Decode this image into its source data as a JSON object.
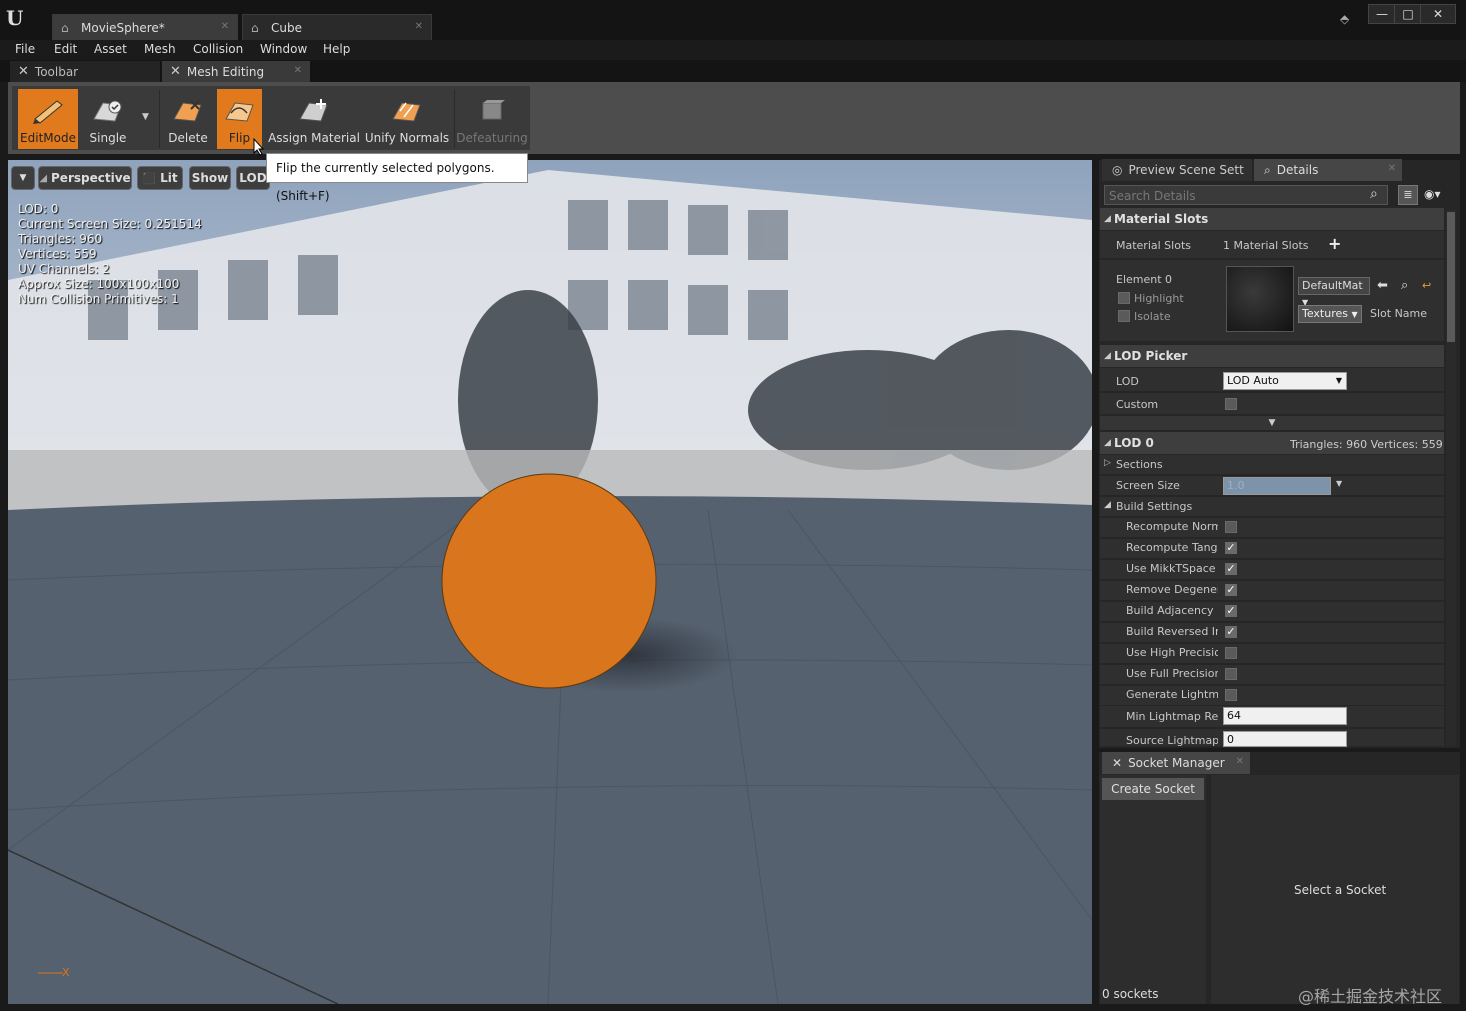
{
  "window": {
    "tabs": [
      {
        "label": "MovieSphere*",
        "icon": "home-icon"
      },
      {
        "label": "Cube",
        "icon": "home-icon"
      }
    ],
    "controls": {
      "minimize": "—",
      "maximize": "□",
      "close": "✕"
    }
  },
  "menu": [
    "File",
    "Edit",
    "Asset",
    "Mesh",
    "Collision",
    "Window",
    "Help"
  ],
  "tool_tabs": [
    {
      "label": "Toolbar",
      "icon": "wrench-icon"
    },
    {
      "label": "Mesh Editing",
      "icon": "wrench-icon"
    }
  ],
  "toolbar": {
    "buttons": [
      {
        "label": "EditMode",
        "icon": "pencil-icon",
        "state": "active"
      },
      {
        "label": "Single",
        "icon": "select-polygon-icon",
        "state": "normal"
      },
      {
        "label": "Delete",
        "icon": "delete-polygon-icon",
        "state": "normal"
      },
      {
        "label": "Flip",
        "icon": "flip-polygon-icon",
        "state": "hovered"
      },
      {
        "label": "Assign Material",
        "icon": "assign-material-icon",
        "state": "normal"
      },
      {
        "label": "Unify Normals",
        "icon": "unify-normals-icon",
        "state": "normal"
      },
      {
        "label": "Defeaturing",
        "icon": "defeaturing-icon",
        "state": "disabled"
      }
    ],
    "accent": "#e07a1c"
  },
  "tooltip": "Flip the currently selected polygons. (Shift+F)",
  "viewport": {
    "buttons": {
      "perspective": "Perspective",
      "lit": "Lit",
      "show": "Show",
      "lod": "LOD"
    },
    "stats": [
      "LOD:  0",
      "Current Screen Size:  0.251514",
      "Triangles:  960",
      "Vertices:  559",
      "UV Channels:  2",
      "Approx Size: 100x100x100",
      "Num Collision Primitives:  1"
    ],
    "axis_label": "X",
    "sphere_color": "#d9751c"
  },
  "details": {
    "tabs": [
      {
        "label": "Preview Scene Sett",
        "icon": "globe-icon"
      },
      {
        "label": "Details",
        "icon": "search-icon"
      }
    ],
    "search_placeholder": "Search Details",
    "material_slots": {
      "header": "Material Slots",
      "label": "Material Slots",
      "count": "1 Material Slots",
      "element": "Element 0",
      "highlight": "Highlight",
      "isolate": "Isolate",
      "material": "DefaultMat",
      "textures": "Textures",
      "slot_name": "Slot Name"
    },
    "lod_picker": {
      "header": "LOD Picker",
      "lod_label": "LOD",
      "lod_value": "LOD Auto",
      "custom_label": "Custom"
    },
    "lod0": {
      "header": "LOD 0",
      "summary": "Triangles: 960   Vertices: 559",
      "sections": "Sections",
      "screen_size_label": "Screen Size",
      "screen_size_value": "1.0",
      "build_settings": "Build Settings",
      "rows": [
        {
          "label": "Recompute Norma",
          "checked": false
        },
        {
          "label": "Recompute Tange",
          "checked": true
        },
        {
          "label": "Use MikkTSpace T",
          "checked": true
        },
        {
          "label": "Remove Degenera",
          "checked": true
        },
        {
          "label": "Build Adjacency B",
          "checked": true
        },
        {
          "label": "Build Reversed Inc",
          "checked": true
        },
        {
          "label": "Use High Precision",
          "checked": false
        },
        {
          "label": "Use Full Precision",
          "checked": false
        },
        {
          "label": "Generate Lightmap",
          "checked": false
        }
      ],
      "min_lightmap_label": "Min Lightmap Res",
      "min_lightmap_value": "64",
      "source_lightmap_label": "Source Lightmap I",
      "source_lightmap_value": "0"
    }
  },
  "socket_manager": {
    "tab": "Socket Manager",
    "create_button": "Create Socket",
    "empty_message": "Select a Socket",
    "count": "0 sockets"
  },
  "watermark": "@稀土掘金技术社区"
}
